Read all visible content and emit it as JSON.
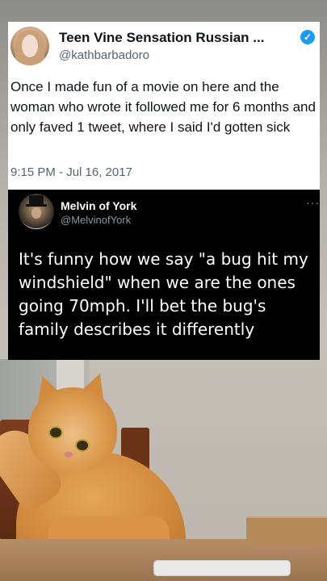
{
  "tweet_light": {
    "display_name": "Teen Vine Sensation Russian ...",
    "handle": "@kathbarbadoro",
    "verified_icon": "verified-badge-icon",
    "body": "Once I made fun of a movie on here and the woman who wrote it followed me for 6 months and only faved 1 tweet, where I said I'd gotten sick",
    "timestamp": "9:15 PM - Jul 16, 2017"
  },
  "tweet_dark": {
    "display_name": "Melvin of York",
    "handle": "@MelvinofYork",
    "more_icon": "more-options-icon",
    "more_glyph": "···",
    "body": "It's funny how we say \"a bug hit my windshield\" when we are the ones going 70mph. I'll bet the bug's family describes it differently"
  },
  "colors": {
    "verified": "#1d9bf0",
    "light_bg": "#ffffff",
    "dark_bg": "#000000",
    "secondary_text": "#536471"
  }
}
